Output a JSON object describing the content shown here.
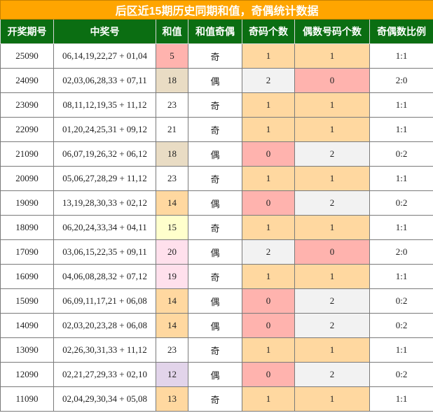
{
  "title": "后区近15期历史同期和值，奇偶统计数据",
  "headers": [
    "开奖期号",
    "中奖号",
    "和值",
    "和值奇偶",
    "奇码个数",
    "偶数号码个数",
    "奇偶数比例"
  ],
  "colors": {
    "title_bg": "#ffa500",
    "header_bg": "#0b6e12",
    "odd_one_bg": "#ffd8a0",
    "zero_bg": "#ffb3ae",
    "neutral_bg": "#f2f2f2"
  },
  "rows": [
    {
      "period": "25090",
      "numbers": "06,14,19,22,27 + 01,04",
      "sum": "5",
      "sum_bg": "#ffb3ae",
      "parity": "奇",
      "odd_count": "1",
      "even_count": "1",
      "ratio": "1:1"
    },
    {
      "period": "24090",
      "numbers": "02,03,06,28,33 + 07,11",
      "sum": "18",
      "sum_bg": "#e9dcc4",
      "parity": "偶",
      "odd_count": "2",
      "even_count": "0",
      "ratio": "2:0"
    },
    {
      "period": "23090",
      "numbers": "08,11,12,19,35 + 11,12",
      "sum": "23",
      "sum_bg": "#ffffff",
      "parity": "奇",
      "odd_count": "1",
      "even_count": "1",
      "ratio": "1:1"
    },
    {
      "period": "22090",
      "numbers": "01,20,24,25,31 + 09,12",
      "sum": "21",
      "sum_bg": "#ffffff",
      "parity": "奇",
      "odd_count": "1",
      "even_count": "1",
      "ratio": "1:1"
    },
    {
      "period": "21090",
      "numbers": "06,07,19,26,32 + 06,12",
      "sum": "18",
      "sum_bg": "#e9dcc4",
      "parity": "偶",
      "odd_count": "0",
      "even_count": "2",
      "ratio": "0:2"
    },
    {
      "period": "20090",
      "numbers": "05,06,27,28,29 + 11,12",
      "sum": "23",
      "sum_bg": "#ffffff",
      "parity": "奇",
      "odd_count": "1",
      "even_count": "1",
      "ratio": "1:1"
    },
    {
      "period": "19090",
      "numbers": "13,19,28,30,33 + 02,12",
      "sum": "14",
      "sum_bg": "#ffd8a0",
      "parity": "偶",
      "odd_count": "0",
      "even_count": "2",
      "ratio": "0:2"
    },
    {
      "period": "18090",
      "numbers": "06,20,24,33,34 + 04,11",
      "sum": "15",
      "sum_bg": "#ffffcc",
      "parity": "奇",
      "odd_count": "1",
      "even_count": "1",
      "ratio": "1:1"
    },
    {
      "period": "17090",
      "numbers": "03,06,15,22,35 + 09,11",
      "sum": "20",
      "sum_bg": "#ffe0ec",
      "parity": "偶",
      "odd_count": "2",
      "even_count": "0",
      "ratio": "2:0"
    },
    {
      "period": "16090",
      "numbers": "04,06,08,28,32 + 07,12",
      "sum": "19",
      "sum_bg": "#ffe0ec",
      "parity": "奇",
      "odd_count": "1",
      "even_count": "1",
      "ratio": "1:1"
    },
    {
      "period": "15090",
      "numbers": "06,09,11,17,21 + 06,08",
      "sum": "14",
      "sum_bg": "#ffd8a0",
      "parity": "偶",
      "odd_count": "0",
      "even_count": "2",
      "ratio": "0:2"
    },
    {
      "period": "14090",
      "numbers": "02,03,20,23,28 + 06,08",
      "sum": "14",
      "sum_bg": "#ffd8a0",
      "parity": "偶",
      "odd_count": "0",
      "even_count": "2",
      "ratio": "0:2"
    },
    {
      "period": "13090",
      "numbers": "02,26,30,31,33 + 11,12",
      "sum": "23",
      "sum_bg": "#ffffff",
      "parity": "奇",
      "odd_count": "1",
      "even_count": "1",
      "ratio": "1:1"
    },
    {
      "period": "12090",
      "numbers": "02,21,27,29,33 + 02,10",
      "sum": "12",
      "sum_bg": "#e2d4ea",
      "parity": "偶",
      "odd_count": "0",
      "even_count": "2",
      "ratio": "0:2"
    },
    {
      "period": "11090",
      "numbers": "02,04,29,30,34 + 05,08",
      "sum": "13",
      "sum_bg": "#ffd8a0",
      "parity": "奇",
      "odd_count": "1",
      "even_count": "1",
      "ratio": "1:1"
    }
  ]
}
